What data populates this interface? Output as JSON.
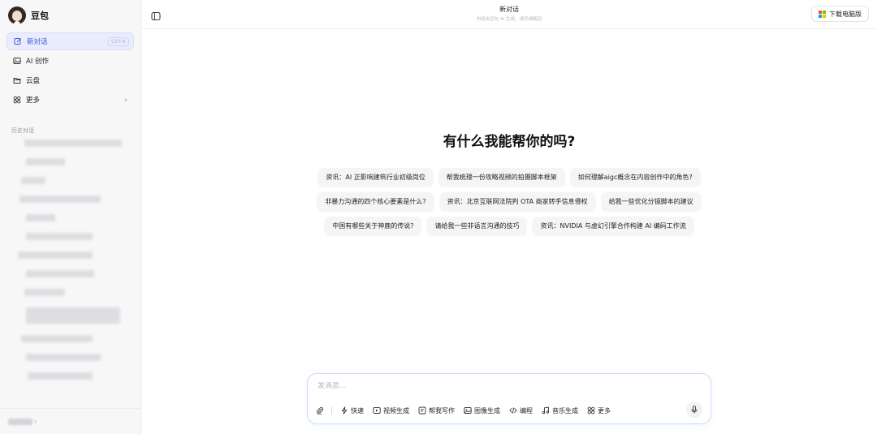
{
  "sidebar": {
    "brand_name": "豆包",
    "nav": [
      {
        "label": "新对话",
        "shortcut": "Ctrl K",
        "icon": "new-chat-icon",
        "active": true
      },
      {
        "label": "AI 创作",
        "icon": "image-icon"
      },
      {
        "label": "云盘",
        "icon": "folder-icon"
      },
      {
        "label": "更多",
        "icon": "grid-icon"
      }
    ],
    "history_title": "历史对话"
  },
  "header": {
    "title": "新对话",
    "subtitle": "内容由豆包 AI 生成，请仔细甄别",
    "download_label": "下载电脑版"
  },
  "main": {
    "hero": "有什么我能帮你的吗?",
    "suggestions": [
      [
        "资讯：AI 正影响建筑行业初级岗位",
        "帮我梳理一份攻略视频的拍摄脚本框架",
        "如何理解aigc概念在内容创作中的角色?"
      ],
      [
        "非暴力沟通的四个核心要素是什么?",
        "资讯：北京互联网法院判 OTA 商家转手信息侵权",
        "给我一些优化分镜脚本的建议"
      ],
      [
        "中国有哪些关于神鹿的传说?",
        "请给我一些非语言沟通的技巧",
        "资讯：NVIDIA 与虚幻引擎合作构建 AI 编码工作流"
      ]
    ]
  },
  "composer": {
    "placeholder": "发消息...",
    "tools": {
      "quick": "快速",
      "video": "视频生成",
      "write": "帮我写作",
      "image": "图像生成",
      "code": "编程",
      "music": "音乐生成",
      "more": "更多"
    }
  },
  "colors": {
    "accent": "#3b5bdb",
    "active_bg": "#e8ecfd",
    "composer_border": "#c9dcf5"
  }
}
